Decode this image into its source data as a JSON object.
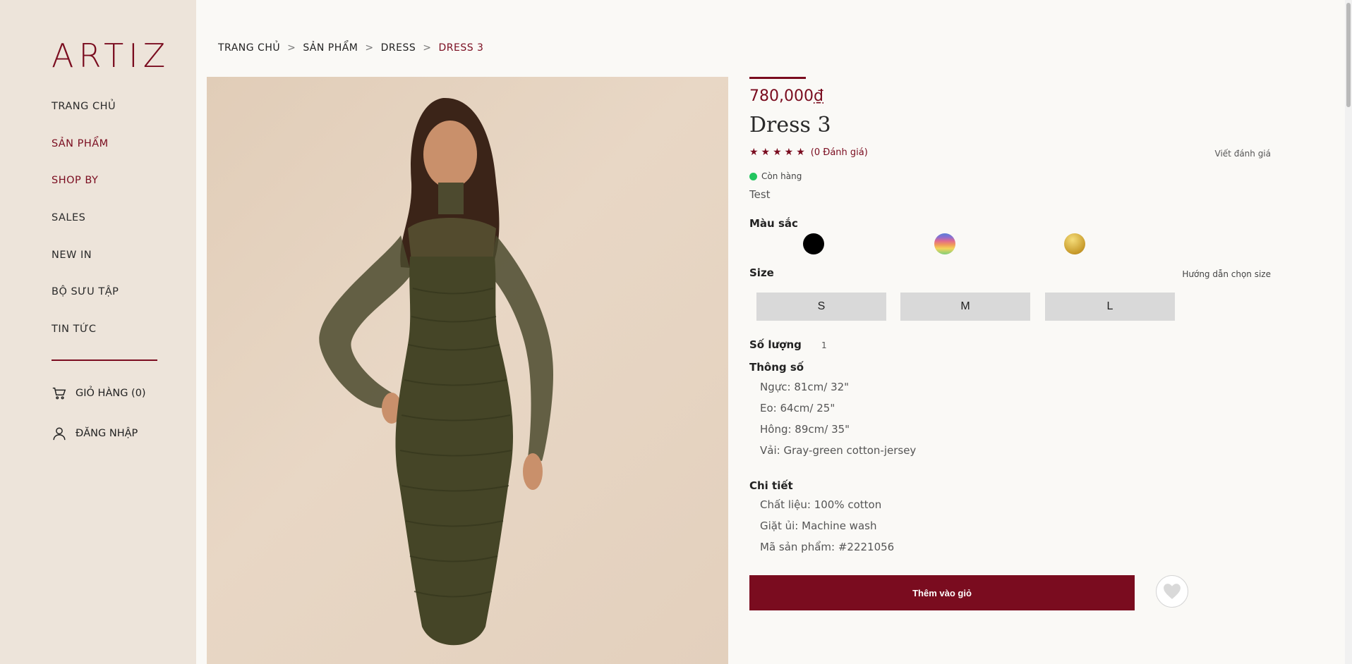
{
  "brand": {
    "logo": "ARTIZ"
  },
  "nav": {
    "items": [
      {
        "label": "TRANG CHỦ"
      },
      {
        "label": "SẢN PHẨM"
      },
      {
        "label": "SHOP BY"
      },
      {
        "label": "SALES"
      },
      {
        "label": "NEW IN"
      },
      {
        "label": "BỘ SƯU TẬP"
      },
      {
        "label": "TIN TỨC"
      }
    ],
    "cart_label": "GIỎ HÀNG (0)",
    "login_label": "ĐĂNG NHẬP"
  },
  "breadcrumb": {
    "items": [
      "TRANG CHỦ",
      "SẢN PHẨM",
      "DRESS",
      "DRESS 3"
    ],
    "separator": ">"
  },
  "product": {
    "price_amount": "780,000",
    "price_currency": "₫",
    "name": "Dress 3",
    "stars": "★★★★★",
    "rating_text": "(0 Đánh giá)",
    "write_review": "Viết đánh giá",
    "stock": "Còn hàng",
    "description": "Test",
    "color_label": "Màu sắc",
    "colors": [
      "black",
      "rainbow-stripe",
      "gold"
    ],
    "size_label": "Size",
    "size_guide": "Hướng dẫn chọn size",
    "sizes": [
      "S",
      "M",
      "L"
    ],
    "quantity_label": "Số lượng",
    "quantity": "1",
    "specs_label": "Thông số",
    "specs": [
      "Ngực: 81cm/ 32\"",
      "Eo: 64cm/ 25\"",
      "Hông: 89cm/ 35\"",
      "Vải: Gray-green cotton-jersey"
    ],
    "details_label": "Chi tiết",
    "details": [
      "Chất liệu: 100% cotton",
      "Giặt ủi: Machine wash",
      "Mã sản phẩm: #2221056"
    ],
    "add_to_cart": "Thêm vào giỏ"
  },
  "colors": {
    "accent": "#7a0c1f",
    "sidebar": "#ede4da",
    "stock_dot": "#22c55e"
  }
}
